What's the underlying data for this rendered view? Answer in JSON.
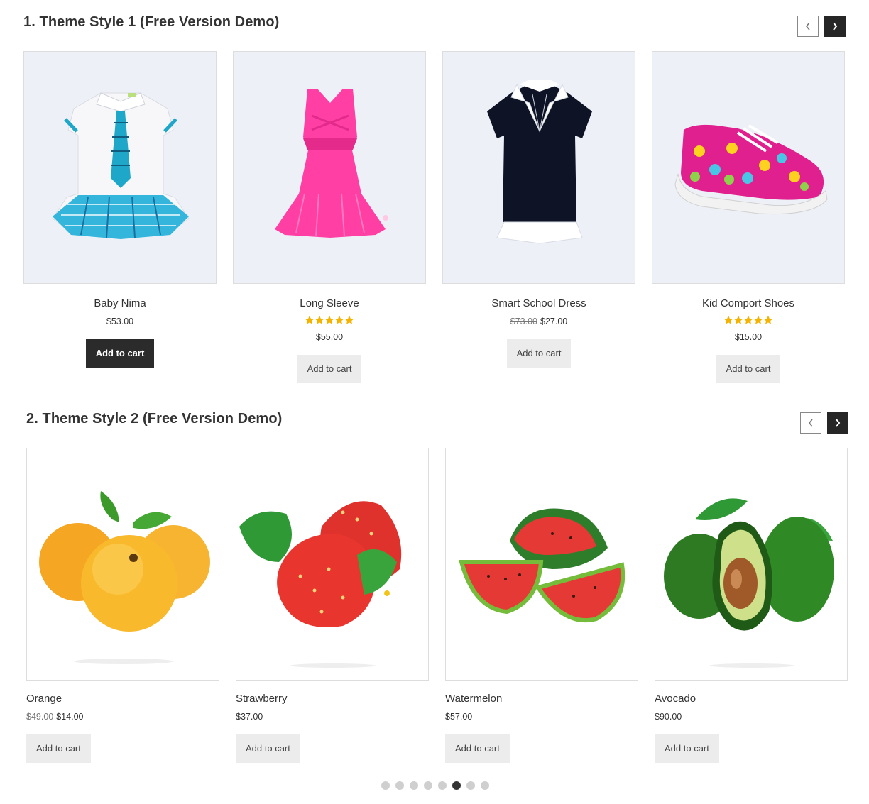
{
  "section1": {
    "title": "1. Theme Style 1 (Free Version Demo)",
    "prev_icon": "chevron-left-icon",
    "next_icon": "chevron-right-icon",
    "products": [
      {
        "name": "Baby Nima",
        "old_price": "",
        "price": "$53.00",
        "rating": 0,
        "button": "Add to cart",
        "image": "school-uniform-dress"
      },
      {
        "name": "Long Sleeve",
        "old_price": "",
        "price": "$55.00",
        "rating": 5,
        "button": "Add to cart",
        "image": "pink-dress"
      },
      {
        "name": "Smart School Dress",
        "old_price": "$73.00",
        "price": "$27.00",
        "rating": 0,
        "button": "Add to cart",
        "image": "navy-top-white-collar"
      },
      {
        "name": "Kid Comport Shoes",
        "old_price": "",
        "price": "$15.00",
        "rating": 5,
        "button": "Add to cart",
        "image": "owl-print-sneaker"
      }
    ]
  },
  "section2": {
    "title": "2. Theme Style 2 (Free Version Demo)",
    "prev_icon": "chevron-left-icon",
    "next_icon": "chevron-right-icon",
    "products": [
      {
        "name": "Orange",
        "old_price": "$49.00",
        "price": "$14.00",
        "button": "Add to cart",
        "image": "peaches"
      },
      {
        "name": "Strawberry",
        "old_price": "",
        "price": "$37.00",
        "button": "Add to cart",
        "image": "strawberries"
      },
      {
        "name": "Watermelon",
        "old_price": "",
        "price": "$57.00",
        "button": "Add to cart",
        "image": "watermelon-slices"
      },
      {
        "name": "Avocado",
        "old_price": "",
        "price": "$90.00",
        "button": "Add to cart",
        "image": "avocados"
      }
    ]
  },
  "pagination": {
    "count": 8,
    "active_index": 5
  },
  "colors": {
    "star": "#f5b301",
    "dark_button": "#2b2b2b",
    "light_button": "#ececec",
    "dot": "#cfcfcf",
    "dot_active": "#333333"
  }
}
